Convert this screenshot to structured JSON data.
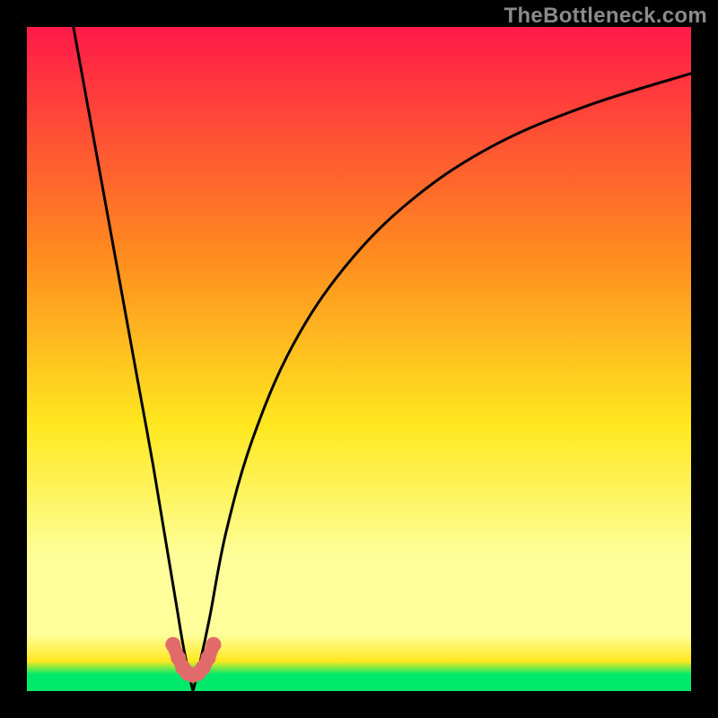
{
  "watermark": "TheBottleneck.com",
  "colors": {
    "red": "#ff1a49",
    "orange": "#ff8a1f",
    "yellow": "#ffe81f",
    "pale_yellow": "#feff9b",
    "green": "#00e96b",
    "curve": "#000000",
    "marker": "#e26a6a"
  },
  "gradient_stops": [
    {
      "offset": 0.0,
      "key": "red"
    },
    {
      "offset": 0.34,
      "key": "orange"
    },
    {
      "offset": 0.6,
      "key": "yellow"
    },
    {
      "offset": 0.8,
      "key": "pale_yellow"
    },
    {
      "offset": 0.915,
      "key": "pale_yellow"
    },
    {
      "offset": 0.955,
      "key": "yellow"
    },
    {
      "offset": 0.975,
      "key": "green"
    },
    {
      "offset": 1.0,
      "key": "green"
    }
  ],
  "chart_data": {
    "type": "line",
    "title": "",
    "xlabel": "",
    "ylabel": "",
    "xlim": [
      0,
      100
    ],
    "ylim": [
      0,
      100
    ],
    "series": [
      {
        "name": "left-branch",
        "x": [
          7,
          9,
          11,
          13,
          15,
          17,
          19,
          21,
          22.5,
          23.5,
          24.3,
          25
        ],
        "y": [
          100,
          89,
          78,
          67,
          56,
          45,
          34,
          22,
          13,
          7,
          3,
          0
        ]
      },
      {
        "name": "right-branch",
        "x": [
          25,
          26,
          27.5,
          30,
          34,
          40,
          48,
          58,
          70,
          84,
          100
        ],
        "y": [
          0,
          4,
          11,
          24,
          38,
          52,
          64,
          74,
          82,
          88,
          93
        ]
      }
    ],
    "vertex": {
      "x": 25,
      "y": 0
    },
    "markers": [
      {
        "x": 22.0,
        "y": 7.0
      },
      {
        "x": 22.8,
        "y": 5.0
      },
      {
        "x": 23.5,
        "y": 3.5
      },
      {
        "x": 24.2,
        "y": 2.7
      },
      {
        "x": 25.0,
        "y": 2.4
      },
      {
        "x": 25.8,
        "y": 2.7
      },
      {
        "x": 26.5,
        "y": 3.5
      },
      {
        "x": 27.3,
        "y": 5.0
      },
      {
        "x": 28.1,
        "y": 7.0
      }
    ]
  }
}
